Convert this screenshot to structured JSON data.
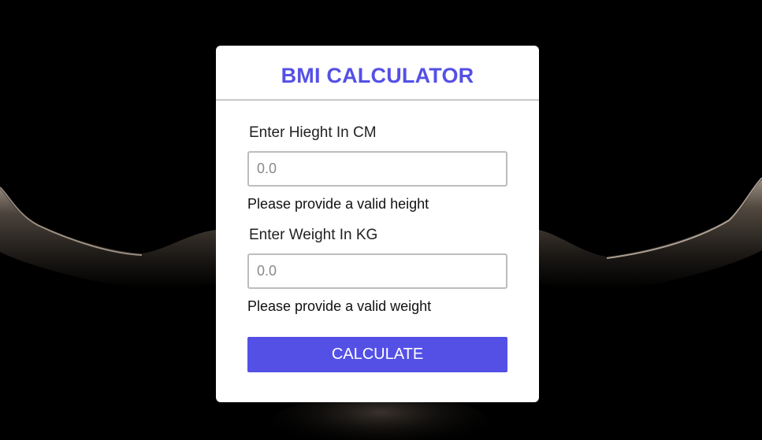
{
  "card": {
    "title": "BMI CALCULATOR"
  },
  "height_field": {
    "label": "Enter Hieght In CM",
    "placeholder": "0.0",
    "hint": "Please provide a valid height"
  },
  "weight_field": {
    "label": "Enter Weight In KG",
    "placeholder": "0.0",
    "hint": "Please provide a valid weight"
  },
  "actions": {
    "calculate_label": "CALCULATE"
  },
  "colors": {
    "accent": "#5450e6",
    "background": "#000000",
    "card": "#ffffff"
  }
}
